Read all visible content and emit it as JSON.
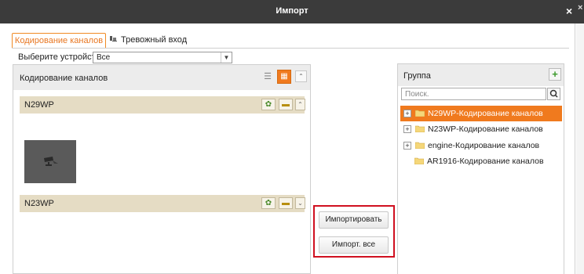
{
  "window": {
    "title": "Импорт",
    "close_label": "×",
    "extra_close_label": "×"
  },
  "tabs": [
    {
      "label": "Кодирование каналов",
      "active": true
    },
    {
      "label": "Тревожный вход",
      "active": false
    }
  ],
  "device": {
    "label": "Выберите устройство",
    "value": "Все"
  },
  "left_panel": {
    "title": "Кодирование каналов",
    "cameras": [
      {
        "name": "N29WP",
        "expanded": true
      },
      {
        "name": "N23WP",
        "expanded": false
      }
    ]
  },
  "actions": {
    "import_label": "Импортировать",
    "import_all_label": "Импорт. все"
  },
  "right_panel": {
    "title": "Группа",
    "search_placeholder": "Поиск.",
    "groups": [
      {
        "label": "N29WP-Кодирование каналов",
        "selected": true,
        "expandable": true
      },
      {
        "label": "N23WP-Кодирование каналов",
        "selected": false,
        "expandable": true
      },
      {
        "label": "engine-Кодирование каналов",
        "selected": false,
        "expandable": true
      },
      {
        "label": "AR1916-Кодирование каналов",
        "selected": false,
        "expandable": false
      }
    ]
  },
  "colors": {
    "accent": "#f07a1e",
    "titlebar": "#3b3b3b",
    "camera_row": "#e5dcc4",
    "highlight_box": "#d01020"
  }
}
